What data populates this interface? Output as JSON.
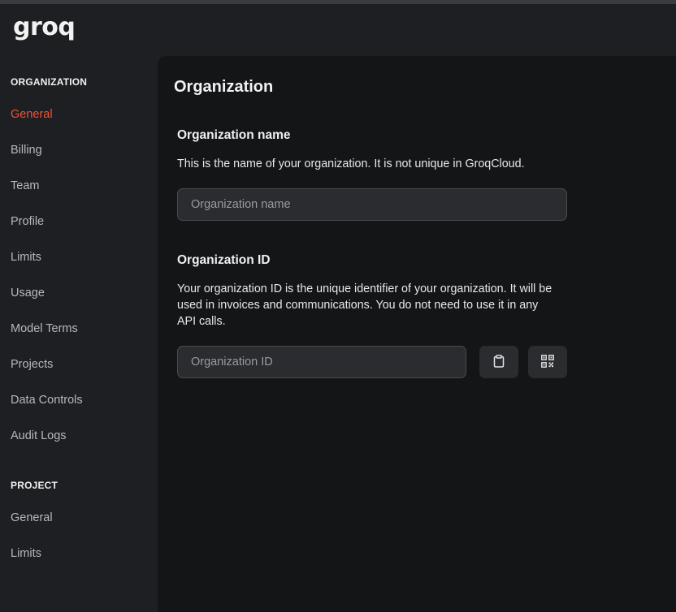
{
  "app": {
    "logo_text": "groq"
  },
  "sidebar": {
    "organization_title": "ORGANIZATION",
    "organization_items": [
      {
        "label": "General",
        "active": true
      },
      {
        "label": "Billing"
      },
      {
        "label": "Team"
      },
      {
        "label": "Profile"
      },
      {
        "label": "Limits"
      },
      {
        "label": "Usage"
      },
      {
        "label": "Model Terms"
      },
      {
        "label": "Projects"
      },
      {
        "label": "Data Controls"
      },
      {
        "label": "Audit Logs"
      }
    ],
    "project_title": "PROJECT",
    "project_items": [
      {
        "label": "General"
      },
      {
        "label": "Limits"
      }
    ]
  },
  "main": {
    "title": "Organization",
    "org_name": {
      "heading": "Organization name",
      "description": "This is the name of your organization. It is not unique in GroqCloud.",
      "placeholder": "Organization name",
      "value": ""
    },
    "org_id": {
      "heading": "Organization ID",
      "description": "Your organization ID is the unique identifier of your organization. It will be used in invoices and communications. You do not need to use it in any API calls.",
      "placeholder": "Organization ID",
      "value": "",
      "copy_icon": "clipboard-icon",
      "qr_icon": "qr-code-icon"
    }
  },
  "colors": {
    "accent": "#f0523a",
    "background": "#1e1f22",
    "panel": "#141517",
    "input_bg": "#2b2c30"
  }
}
